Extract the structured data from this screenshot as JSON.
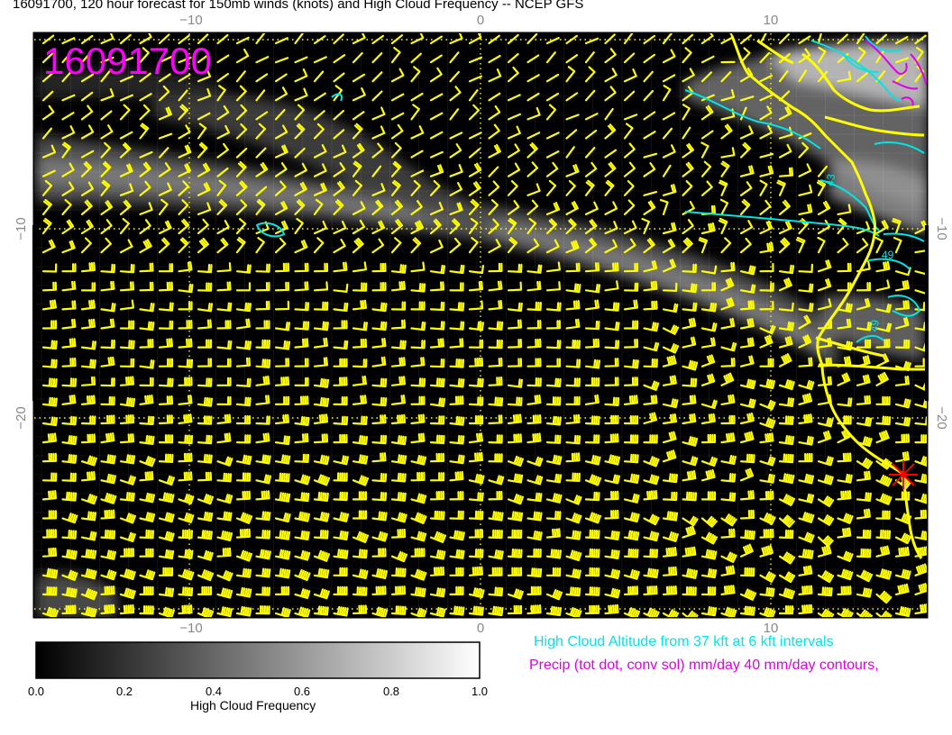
{
  "title": "16091700, 120 hour forecast for 150mb winds (knots) and High Cloud Frequency -- NCEP GFS",
  "stamp": "16091700",
  "stamp_color": "#ff00ff",
  "axes": {
    "lon_ticks": [
      "−10",
      "0",
      "10"
    ],
    "lat_ticks": [
      "−10",
      "−20"
    ]
  },
  "legend": {
    "cloud_altitude": "High Cloud Altitude from 37 kft at 6 kft intervals",
    "precip": "Precip (tot dot, conv sol) mm/day 40 mm/day contours,"
  },
  "colorbar": {
    "title": "High Cloud Frequency",
    "ticks": [
      "0.0",
      "0.2",
      "0.4",
      "0.6",
      "0.8",
      "1.0"
    ]
  },
  "contour_labels": [
    "43",
    "49",
    "49"
  ],
  "colors": {
    "wind_barbs": "#ffff00",
    "coastline": "#ffff00",
    "altitude_contours": "#00e5e5",
    "precip_contours": "#e000e0",
    "marker": "#ff0000",
    "background": "#000000"
  }
}
